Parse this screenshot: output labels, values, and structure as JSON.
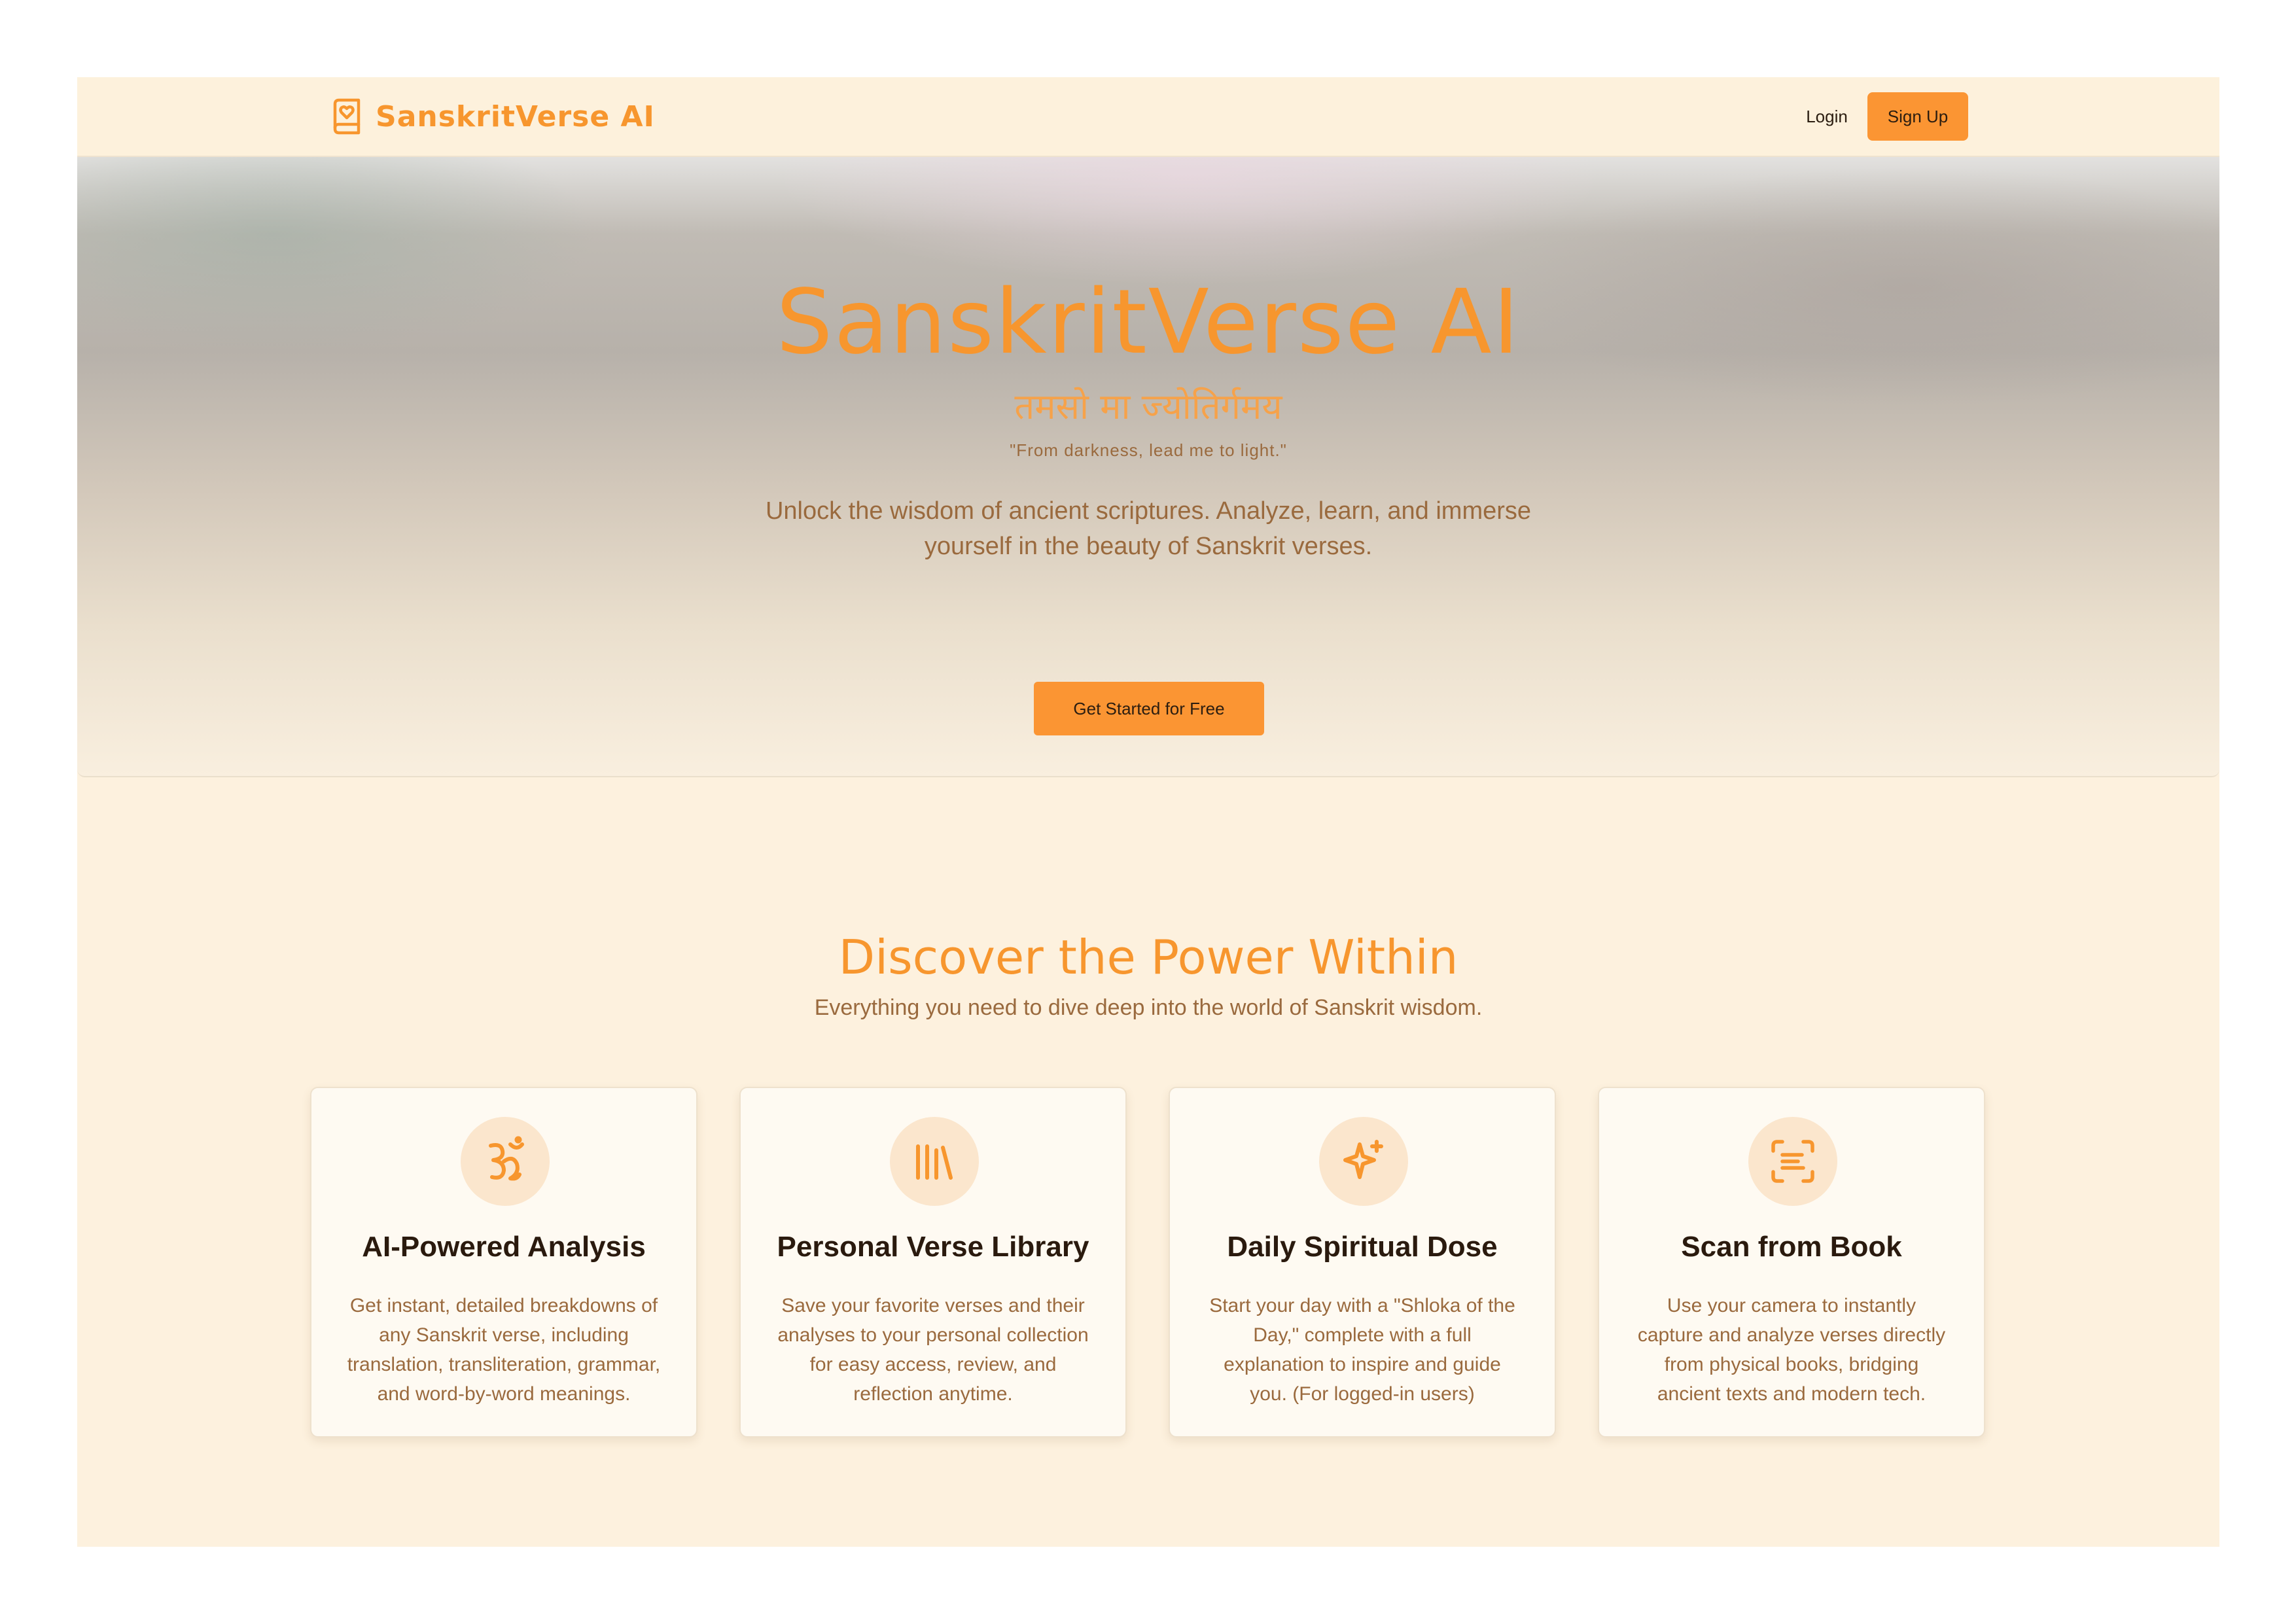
{
  "header": {
    "brand_name": "SanskritVerse AI",
    "brand_icon": "book-heart-icon",
    "login_label": "Login",
    "signup_label": "Sign Up"
  },
  "hero": {
    "title": "SanskritVerse AI",
    "sanskrit_line": "तमसो मा ज्योतिर्गमय",
    "quote": "\"From darkness, lead me to light.\"",
    "description": "Unlock the wisdom of ancient scriptures. Analyze, learn, and immerse yourself in the beauty of Sanskrit verses.",
    "cta_label": "Get Started for Free"
  },
  "features": {
    "title": "Discover the Power Within",
    "subtitle": "Everything you need to dive deep into the world of Sanskrit wisdom.",
    "cards": [
      {
        "icon": "om-icon",
        "title": "AI-Powered Analysis",
        "description": "Get instant, detailed breakdowns of any Sanskrit verse, including translation, transliteration, grammar, and word-by-word meanings."
      },
      {
        "icon": "library-icon",
        "title": "Personal Verse Library",
        "description": "Save your favorite verses and their analyses to your personal collection for easy access, review, and reflection anytime."
      },
      {
        "icon": "sparkles-icon",
        "title": "Daily Spiritual Dose",
        "description": "Start your day with a \"Shloka of the Day,\" complete with a full explanation to inspire and guide you. (For logged-in users)"
      },
      {
        "icon": "scan-text-icon",
        "title": "Scan from Book",
        "description": "Use your camera to instantly capture and analyze verses directly from physical books, bridging ancient texts and modern tech."
      }
    ]
  },
  "colors": {
    "accent": "#f7962e",
    "button": "#fb9533",
    "background": "#fdf1de",
    "text_muted": "#9a6a3e",
    "text_dark": "#2a1a0e"
  }
}
